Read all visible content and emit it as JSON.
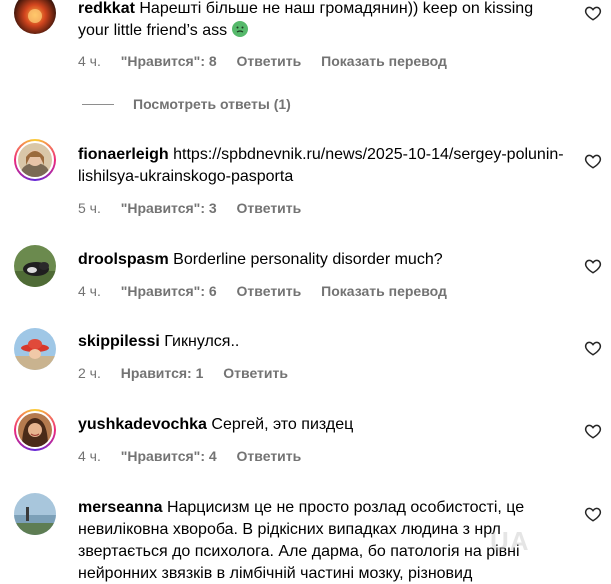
{
  "comments": [
    {
      "username": "redkkat",
      "text": "Нарешті більше не наш громадянин)) keep on kissing your little friend’s ass",
      "emoji": "nauseated-face-emoji",
      "time": "4 ч.",
      "likes": "\"Нравится\": 8",
      "reply": "Ответить",
      "translate": "Показать перевод"
    },
    {
      "username": "fionaerleigh",
      "text": "https://spbdnevnik.ru/news/2025-10-14/sergey-polunin-lishilsya-ukrainskogo-pasporta",
      "time": "5 ч.",
      "likes": "\"Нравится\": 3",
      "reply": "Ответить"
    },
    {
      "username": "droolspasm",
      "text": "Borderline personality disorder much?",
      "time": "4 ч.",
      "likes": "\"Нравится\": 6",
      "reply": "Ответить",
      "translate": "Показать перевод"
    },
    {
      "username": "skippilessi",
      "text": "Гикнулся..",
      "time": "2 ч.",
      "likes": "Нравится: 1",
      "reply": "Ответить"
    },
    {
      "username": "yushkadevochka",
      "text": "Сергей, это пиздец",
      "time": "4 ч.",
      "likes": "\"Нравится\": 4",
      "reply": "Ответить"
    },
    {
      "username": "merseanna",
      "text": "Нарцисизм це не просто розлад особистості, це невиліковна хвороба. В рідкісних випадках людина з нрл звертається до психолога. Але дарма, бо патологія на рівні нейронних звязків в лімбічній частині мозку, різновид"
    }
  ],
  "view_replies": "Посмотреть ответы (1)",
  "watermark": "UA",
  "icons": {
    "like": "heart-outline-icon"
  },
  "colors": {
    "meta_text": "#737373",
    "story_ring": [
      "#f9ce34",
      "#ee2a7b",
      "#6228d7"
    ]
  }
}
